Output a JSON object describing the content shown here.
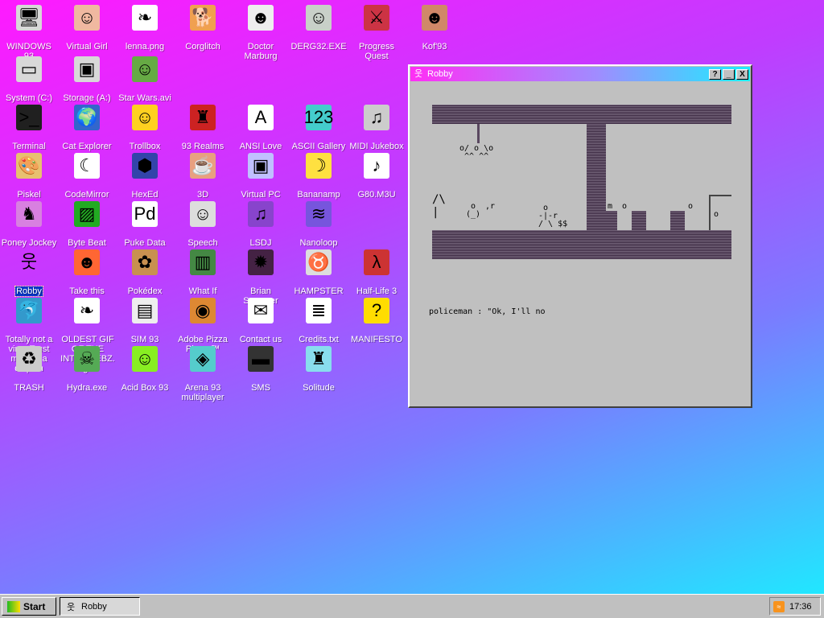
{
  "desktop": {
    "icons": [
      {
        "label": "WINDOWS 93",
        "glyph": "🖥",
        "bg": "#d8d8d8"
      },
      {
        "label": "Virtual Girl",
        "glyph": "☺",
        "bg": "#f0b8a0"
      },
      {
        "label": "lenna.png",
        "glyph": "❧",
        "bg": "#ffffff"
      },
      {
        "label": "Corglitch",
        "glyph": "🐕",
        "bg": "#f0a050"
      },
      {
        "label": "Doctor Marburg",
        "glyph": "☻",
        "bg": "#eeeeee"
      },
      {
        "label": "DERG32.EXE",
        "glyph": "☺",
        "bg": "#c8d0c8"
      },
      {
        "label": "Progress Quest",
        "glyph": "⚔",
        "bg": "#cc3344"
      },
      {
        "label": "Kof'93",
        "glyph": "☻",
        "bg": "#d08868"
      },
      {
        "label": "System (C:)",
        "glyph": "▭",
        "bg": "#d8d8d8"
      },
      {
        "label": "Storage (A:)",
        "glyph": "▣",
        "bg": "#d8d8d8"
      },
      {
        "label": "Star Wars.avi",
        "glyph": "☺",
        "bg": "#66aa44"
      },
      {
        "label": "Terminal",
        "glyph": ">_",
        "bg": "#202020"
      },
      {
        "label": "Cat Explorer",
        "glyph": "🌍",
        "bg": "#3366cc"
      },
      {
        "label": "Trollbox",
        "glyph": "☺",
        "bg": "#ffd020"
      },
      {
        "label": "93 Realms",
        "glyph": "♜",
        "bg": "#cc2222"
      },
      {
        "label": "ANSI Love",
        "glyph": "A",
        "bg": "#ffffff"
      },
      {
        "label": "ASCII Gallery",
        "glyph": "123",
        "bg": "#44cccc"
      },
      {
        "label": "MIDI Jukebox",
        "glyph": "♫",
        "bg": "#cccccc"
      },
      {
        "label": "Piskel",
        "glyph": "🎨",
        "bg": "#e8c070"
      },
      {
        "label": "CodeMirror",
        "glyph": "☾",
        "bg": "#ffffff"
      },
      {
        "label": "HexEd",
        "glyph": "⬢",
        "bg": "#3344aa"
      },
      {
        "label": "3D",
        "glyph": "☕",
        "bg": "#e8a080"
      },
      {
        "label": "Virtual PC",
        "glyph": "▣",
        "bg": "#c0c0ff"
      },
      {
        "label": "Bananamp",
        "glyph": "☽",
        "bg": "#ffe040"
      },
      {
        "label": "G80.M3U",
        "glyph": "♪",
        "bg": "#ffffff"
      },
      {
        "label": "Poney Jockey",
        "glyph": "♞",
        "bg": "#d880e0"
      },
      {
        "label": "Byte Beat",
        "glyph": "▨",
        "bg": "#22aa22"
      },
      {
        "label": "Puke Data",
        "glyph": "Pd",
        "bg": "#ffffff"
      },
      {
        "label": "Speech",
        "glyph": "☺",
        "bg": "#dddddd"
      },
      {
        "label": "LSDJ",
        "glyph": "♫",
        "bg": "#8844cc"
      },
      {
        "label": "Nanoloop",
        "glyph": "≋",
        "bg": "#7755dd"
      },
      {
        "label": "Robby",
        "glyph": "웃",
        "bg": "transparent"
      },
      {
        "label": "Take this",
        "glyph": "☻",
        "bg": "#ff6633"
      },
      {
        "label": "Pokédex",
        "glyph": "✿",
        "bg": "#c89050"
      },
      {
        "label": "What If",
        "glyph": "▥",
        "bg": "#448844"
      },
      {
        "label": "Brian Sweeper",
        "glyph": "✹",
        "bg": "#442244"
      },
      {
        "label": "HAMPSTER",
        "glyph": "♉",
        "bg": "#dddddd"
      },
      {
        "label": "Half-Life 3",
        "glyph": "λ",
        "bg": "#cc3333"
      },
      {
        "label": "Totally not a virus.Trust me...im a dolphin",
        "glyph": "🐬",
        "bg": "#3399cc"
      },
      {
        "label": "OLDEST GIF OF THE INTERWEBZ.gif",
        "glyph": "❧",
        "bg": "#ffffff"
      },
      {
        "label": "SIM 93",
        "glyph": "▤",
        "bg": "#eeeeee"
      },
      {
        "label": "Adobe Pizza Player™",
        "glyph": "◉",
        "bg": "#dd8833"
      },
      {
        "label": "Contact us",
        "glyph": "✉",
        "bg": "#ffffff"
      },
      {
        "label": "Credits.txt",
        "glyph": "≣",
        "bg": "#ffffff"
      },
      {
        "label": "MANIFESTO",
        "glyph": "?",
        "bg": "#ffdd00"
      },
      {
        "label": "TRASH",
        "glyph": "♻",
        "bg": "#cccccc"
      },
      {
        "label": "Hydra.exe",
        "glyph": "☠",
        "bg": "#55aa55"
      },
      {
        "label": "Acid Box 93",
        "glyph": "☺",
        "bg": "#88ee22"
      },
      {
        "label": "Arena 93 multiplayer",
        "glyph": "◈",
        "bg": "#55cccc"
      },
      {
        "label": "SMS",
        "glyph": "▬",
        "bg": "#333333"
      },
      {
        "label": "Solitude",
        "glyph": "♜",
        "bg": "#88ddee"
      }
    ],
    "selected": "Robby"
  },
  "window": {
    "title": "Robby",
    "help_label": "?",
    "minimize_label": "_",
    "close_label": "X",
    "game": {
      "ascii_hanging": "o/ o \\o\n ^^ ^^",
      "ascii_left": "/\\\n|",
      "ascii_robby": " o\n(_)",
      "ascii_robby_tag": ",r",
      "ascii_thief": " o\n-|-r\n/ \\ $$",
      "ascii_npc1": "m  o",
      "ascii_npc2": "o",
      "ascii_door": "o",
      "dialog": "policeman : \"Ok, I'll no"
    }
  },
  "taskbar": {
    "start_label": "Start",
    "task_label": "Robby",
    "clock": "17:36"
  }
}
